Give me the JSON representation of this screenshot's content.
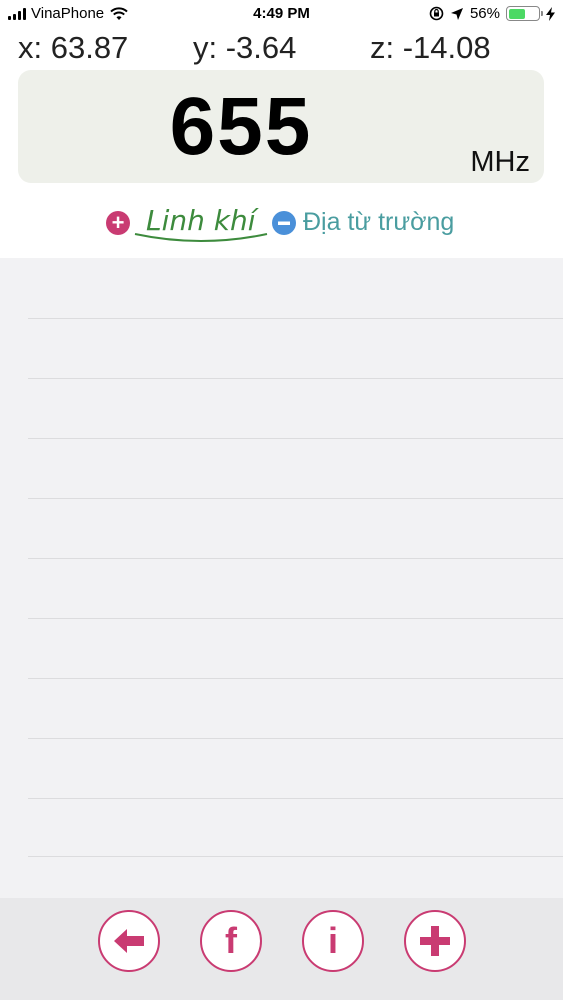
{
  "status_bar": {
    "carrier": "VinaPhone",
    "time": "4:49 PM",
    "battery_percent": "56%",
    "battery_level": 0.56
  },
  "axes": {
    "x": "x: 63.87",
    "y": "y: -3.64",
    "z": "z: -14.08"
  },
  "reading": {
    "value": "655",
    "unit": "MHz"
  },
  "legend": {
    "positive": {
      "icon": "plus-circle-icon",
      "label": "Linh khí",
      "color": "#c93b72"
    },
    "negative": {
      "icon": "minus-circle-icon",
      "label": "Địa từ trường",
      "color": "#4a90d9"
    }
  },
  "toolbar": {
    "buttons": [
      {
        "name": "back-button",
        "icon": "arrow-left-icon"
      },
      {
        "name": "facebook-button",
        "icon": "facebook-icon",
        "glyph": "f"
      },
      {
        "name": "info-button",
        "icon": "info-icon",
        "glyph": "i"
      },
      {
        "name": "add-button",
        "icon": "plus-icon"
      }
    ]
  }
}
